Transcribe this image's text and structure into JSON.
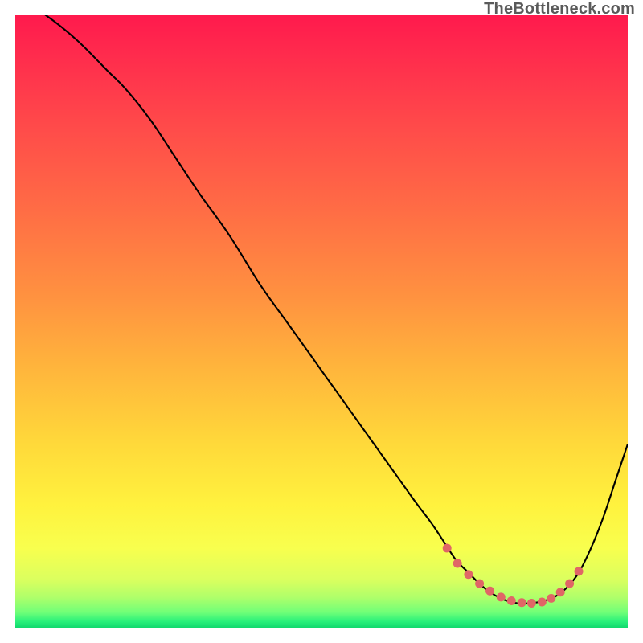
{
  "attribution": "TheBottleneck.com",
  "chart_data": {
    "type": "line",
    "title": "",
    "xlabel": "",
    "ylabel": "",
    "xlim": [
      0,
      100
    ],
    "ylim": [
      0,
      100
    ],
    "grid": false,
    "series": [
      {
        "name": "bottleneck-curve",
        "color": "#000000",
        "x": [
          0,
          5,
          10,
          15,
          18,
          22,
          26,
          30,
          35,
          40,
          45,
          50,
          55,
          60,
          65,
          68,
          70,
          72,
          74,
          76,
          78,
          80,
          82,
          84,
          86,
          88,
          90,
          92,
          94,
          96,
          98,
          100
        ],
        "y": [
          103,
          100,
          96,
          91,
          88,
          83,
          77,
          71,
          64,
          56,
          49,
          42,
          35,
          28,
          21,
          17,
          14,
          11,
          9,
          7,
          5.5,
          4.5,
          4,
          4,
          4.3,
          5,
          6.5,
          9,
          13,
          18,
          24,
          30
        ]
      },
      {
        "name": "optimal-zone-markers",
        "color": "#e06666",
        "type": "scatter",
        "marker_size": 5,
        "x": [
          70.5,
          72.2,
          74.0,
          75.8,
          77.5,
          79.3,
          81.0,
          82.7,
          84.3,
          86.0,
          87.5,
          89.0,
          90.5,
          92.0
        ],
        "y": [
          13.0,
          10.5,
          8.7,
          7.2,
          6.0,
          5.0,
          4.4,
          4.1,
          4.0,
          4.2,
          4.8,
          5.8,
          7.2,
          9.2
        ]
      }
    ],
    "background_gradient_stops": [
      {
        "offset": 0.0,
        "color": "#ff1a4d"
      },
      {
        "offset": 0.06,
        "color": "#ff2a4d"
      },
      {
        "offset": 0.18,
        "color": "#ff4a4a"
      },
      {
        "offset": 0.32,
        "color": "#ff6d45"
      },
      {
        "offset": 0.46,
        "color": "#ff9240"
      },
      {
        "offset": 0.58,
        "color": "#ffb63c"
      },
      {
        "offset": 0.7,
        "color": "#ffd93a"
      },
      {
        "offset": 0.8,
        "color": "#fff23e"
      },
      {
        "offset": 0.87,
        "color": "#f8ff4e"
      },
      {
        "offset": 0.92,
        "color": "#dcff5e"
      },
      {
        "offset": 0.95,
        "color": "#b0ff6a"
      },
      {
        "offset": 0.975,
        "color": "#70ff78"
      },
      {
        "offset": 0.99,
        "color": "#28f07a"
      },
      {
        "offset": 1.0,
        "color": "#10d86e"
      }
    ]
  }
}
